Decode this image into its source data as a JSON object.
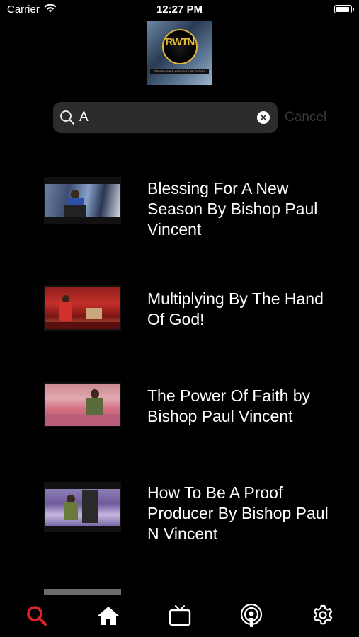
{
  "status_bar": {
    "carrier": "Carrier",
    "time": "12:27 PM"
  },
  "logo": {
    "letters": "RWTN",
    "tagline": "REMARKABLE WORLD TV NETWORK"
  },
  "search": {
    "value": "A",
    "cancel_label": "Cancel"
  },
  "results": [
    {
      "title": "Blessing For A New Season By Bishop Paul Vincent",
      "thumbnail": "preacher-at-pulpit"
    },
    {
      "title": "Multiplying By The Hand Of God!",
      "thumbnail": "red-stage-worship"
    },
    {
      "title": "The Power Of Faith by Bishop Paul Vincent",
      "thumbnail": "preacher-pink-stage"
    },
    {
      "title": "How To Be A Proof Producer By Bishop Paul N Vincent",
      "thumbnail": "preacher-purple-stage"
    }
  ],
  "tab_bar": {
    "active_color": "#e0262a",
    "tabs": [
      {
        "icon": "search-icon",
        "active": true
      },
      {
        "icon": "home-icon",
        "active": false
      },
      {
        "icon": "tv-icon",
        "active": false
      },
      {
        "icon": "podcast-icon",
        "active": false
      },
      {
        "icon": "gear-icon",
        "active": false
      }
    ]
  }
}
